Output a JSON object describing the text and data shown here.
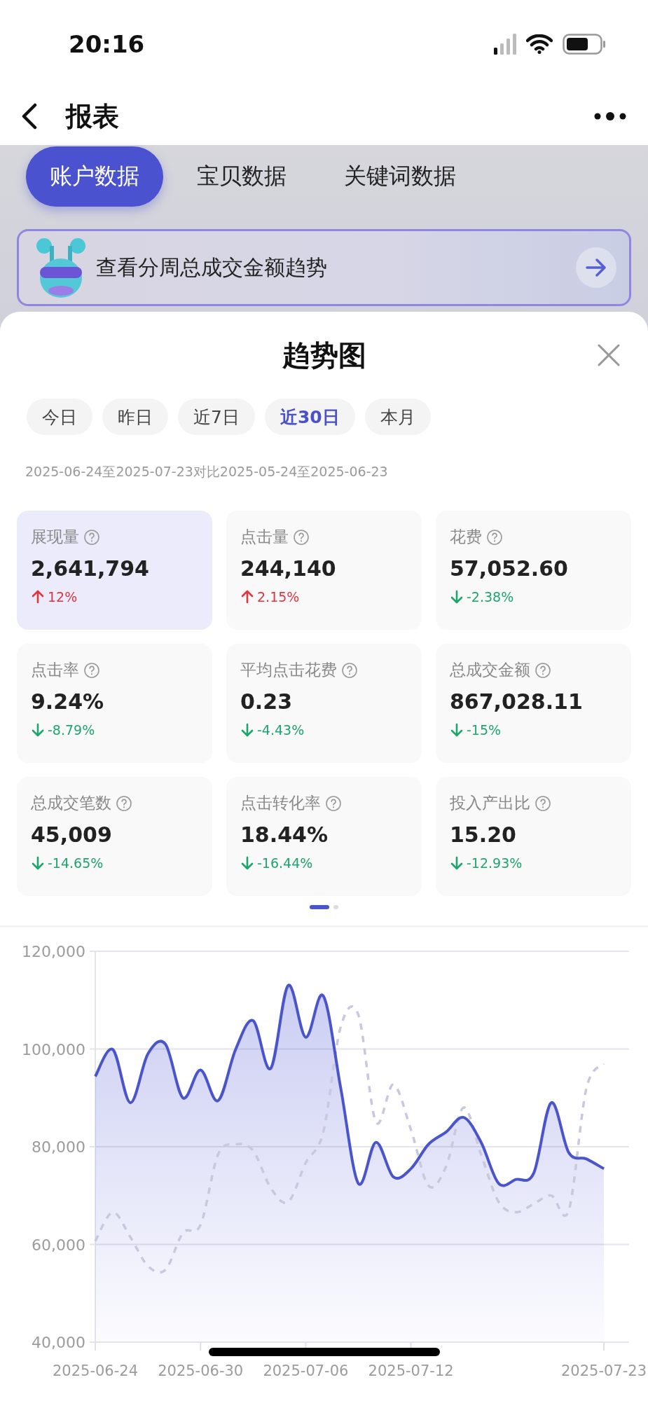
{
  "status_bar": {
    "time": "20:16"
  },
  "nav": {
    "title": "报表"
  },
  "tabs": [
    {
      "label": "账户数据",
      "selected": true
    },
    {
      "label": "宝贝数据",
      "selected": false
    },
    {
      "label": "关键词数据",
      "selected": false
    }
  ],
  "banner": {
    "text": "查看分周总成交金额趋势"
  },
  "sheet": {
    "title": "趋势图",
    "ranges": [
      {
        "label": "今日",
        "selected": false
      },
      {
        "label": "昨日",
        "selected": false
      },
      {
        "label": "近7日",
        "selected": false
      },
      {
        "label": "近30日",
        "selected": true
      },
      {
        "label": "本月",
        "selected": false
      }
    ],
    "compare_text": "2025-06-24至2025-07-23对比2025-05-24至2025-06-23",
    "metrics": [
      {
        "label": "展现量",
        "value": "2,641,794",
        "change": "12%",
        "kind": "up",
        "selected": true
      },
      {
        "label": "点击量",
        "value": "244,140",
        "change": "2.15%",
        "kind": "up",
        "selected": false
      },
      {
        "label": "花费",
        "value": "57,052.60",
        "change": "-2.38%",
        "kind": "down",
        "selected": false
      },
      {
        "label": "点击率",
        "value": "9.24%",
        "change": "-8.79%",
        "kind": "down",
        "selected": false
      },
      {
        "label": "平均点击花费",
        "value": "0.23",
        "change": "-4.43%",
        "kind": "down",
        "selected": false
      },
      {
        "label": "总成交金额",
        "value": "867,028.11",
        "change": "-15%",
        "kind": "down",
        "selected": false
      },
      {
        "label": "总成交笔数",
        "value": "45,009",
        "change": "-14.65%",
        "kind": "down",
        "selected": false
      },
      {
        "label": "点击转化率",
        "value": "18.44%",
        "change": "-16.44%",
        "kind": "down",
        "selected": false
      },
      {
        "label": "投入产出比",
        "value": "15.20",
        "change": "-12.93%",
        "kind": "down",
        "selected": false
      }
    ],
    "pages": [
      {
        "selected": true
      },
      {
        "selected": false
      }
    ],
    "chart_data": {
      "type": "area",
      "grid": true,
      "categories": [
        "2025-06-24",
        null,
        null,
        null,
        null,
        null,
        "2025-06-30",
        null,
        null,
        null,
        null,
        null,
        "2025-07-06",
        null,
        null,
        null,
        null,
        null,
        "2025-07-12",
        null,
        null,
        null,
        null,
        null,
        null,
        null,
        null,
        null,
        null,
        "2025-07-23"
      ],
      "series": [
        {
          "type": "area",
          "color": "#4a55cc",
          "line_style": "solid",
          "values": [
            94400,
            99900,
            89000,
            99000,
            101000,
            90000,
            95700,
            89400,
            99900,
            105800,
            96000,
            113000,
            102400,
            110900,
            91900,
            72500,
            80900,
            73800,
            75500,
            80500,
            83000,
            86000,
            80900,
            72500,
            73300,
            74600,
            89000,
            78800,
            77500,
            75500
          ]
        },
        {
          "type": "line",
          "color": "#c8c8de",
          "line_style": "dashed",
          "values": [
            60700,
            66600,
            61500,
            55600,
            54800,
            62400,
            64000,
            78400,
            80500,
            79200,
            71600,
            68700,
            76700,
            83000,
            104600,
            107000,
            85100,
            92700,
            83500,
            72000,
            75900,
            88000,
            78400,
            68700,
            66600,
            68300,
            70000,
            67000,
            91900,
            97000
          ]
        }
      ],
      "ylim": [
        40000,
        120000
      ],
      "yticks": [
        {
          "value": 40000,
          "label": "40,000"
        },
        {
          "value": 60000,
          "label": "60,000"
        },
        {
          "value": 80000,
          "label": "80,000"
        },
        {
          "value": 100000,
          "label": "100,000"
        },
        {
          "value": 120000,
          "label": "120,000"
        }
      ]
    }
  }
}
